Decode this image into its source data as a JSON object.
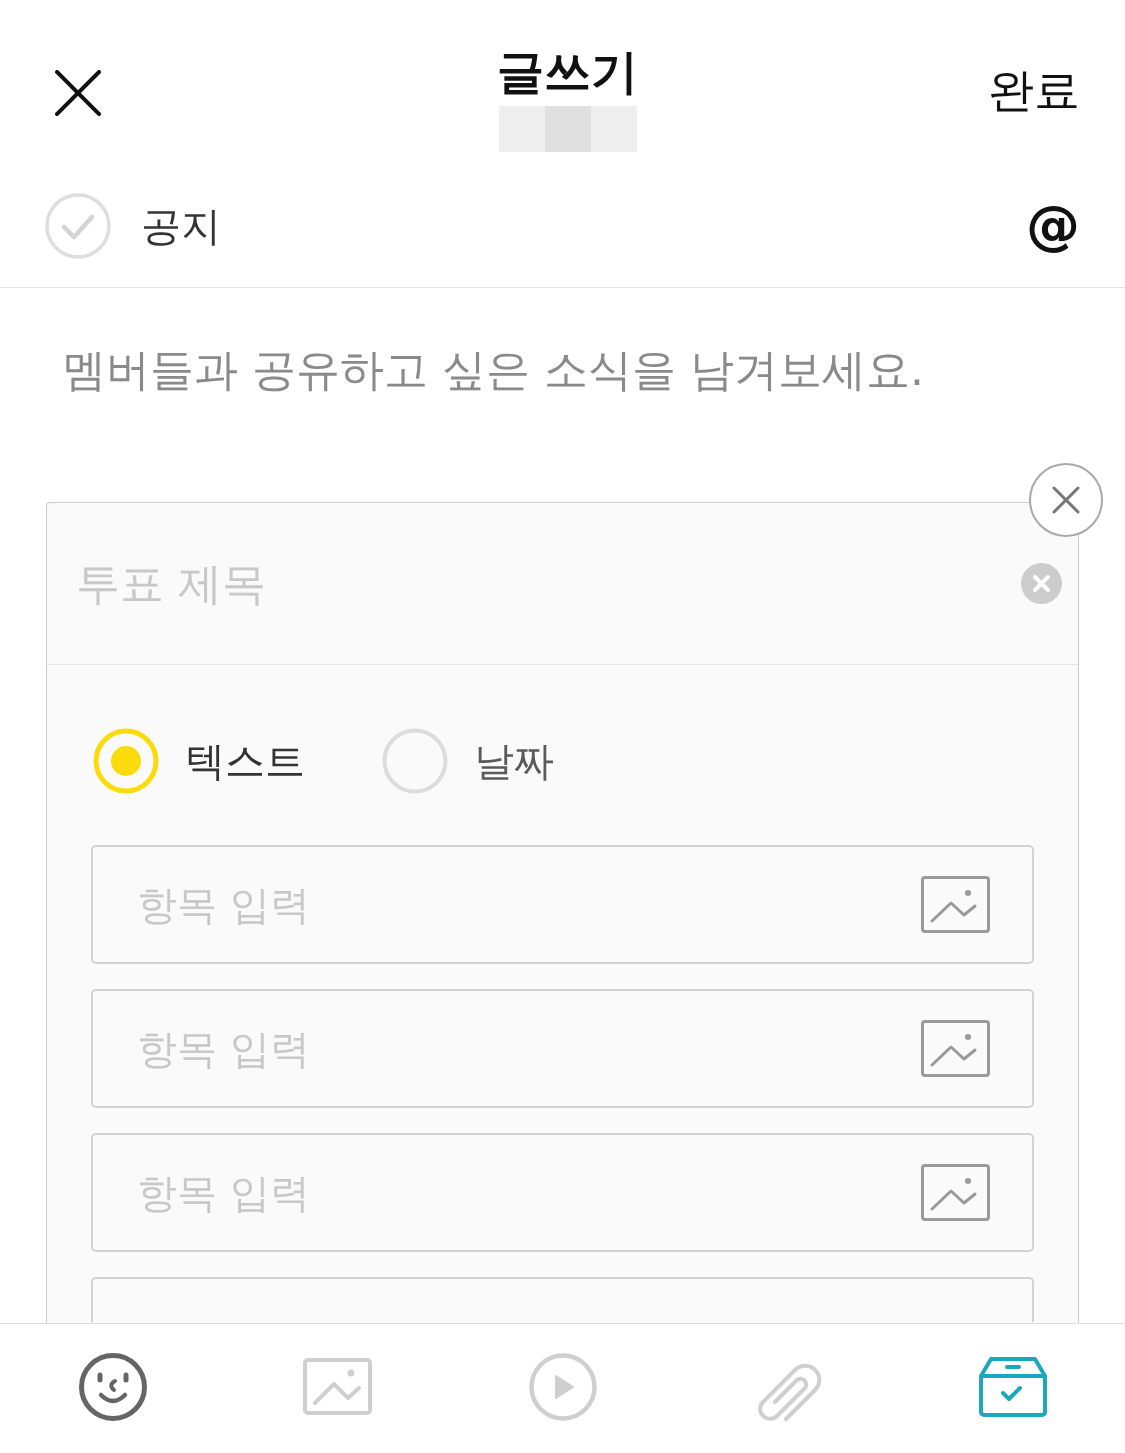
{
  "header": {
    "title": "글쓰기",
    "done": "완료"
  },
  "notice": {
    "label": "공지",
    "checked": false
  },
  "mention": "@",
  "post": {
    "placeholder": "멤버들과 공유하고 싶은 소식을 남겨보세요."
  },
  "poll": {
    "title_placeholder": "투표 제목",
    "type_options": [
      {
        "label": "텍스트",
        "selected": true
      },
      {
        "label": "날짜",
        "selected": false
      }
    ],
    "items": [
      {
        "kind": "input",
        "placeholder": "항목 입력"
      },
      {
        "kind": "input",
        "placeholder": "항목 입력"
      },
      {
        "kind": "input",
        "placeholder": "항목 입력"
      },
      {
        "kind": "partial"
      }
    ]
  },
  "toolbar": [
    {
      "kind": "emoji",
      "selected": false,
      "disabled": false
    },
    {
      "kind": "photo",
      "selected": false,
      "disabled": true
    },
    {
      "kind": "video",
      "selected": false,
      "disabled": true
    },
    {
      "kind": "file",
      "selected": false,
      "disabled": true
    },
    {
      "kind": "poll",
      "selected": true,
      "disabled": false
    }
  ]
}
